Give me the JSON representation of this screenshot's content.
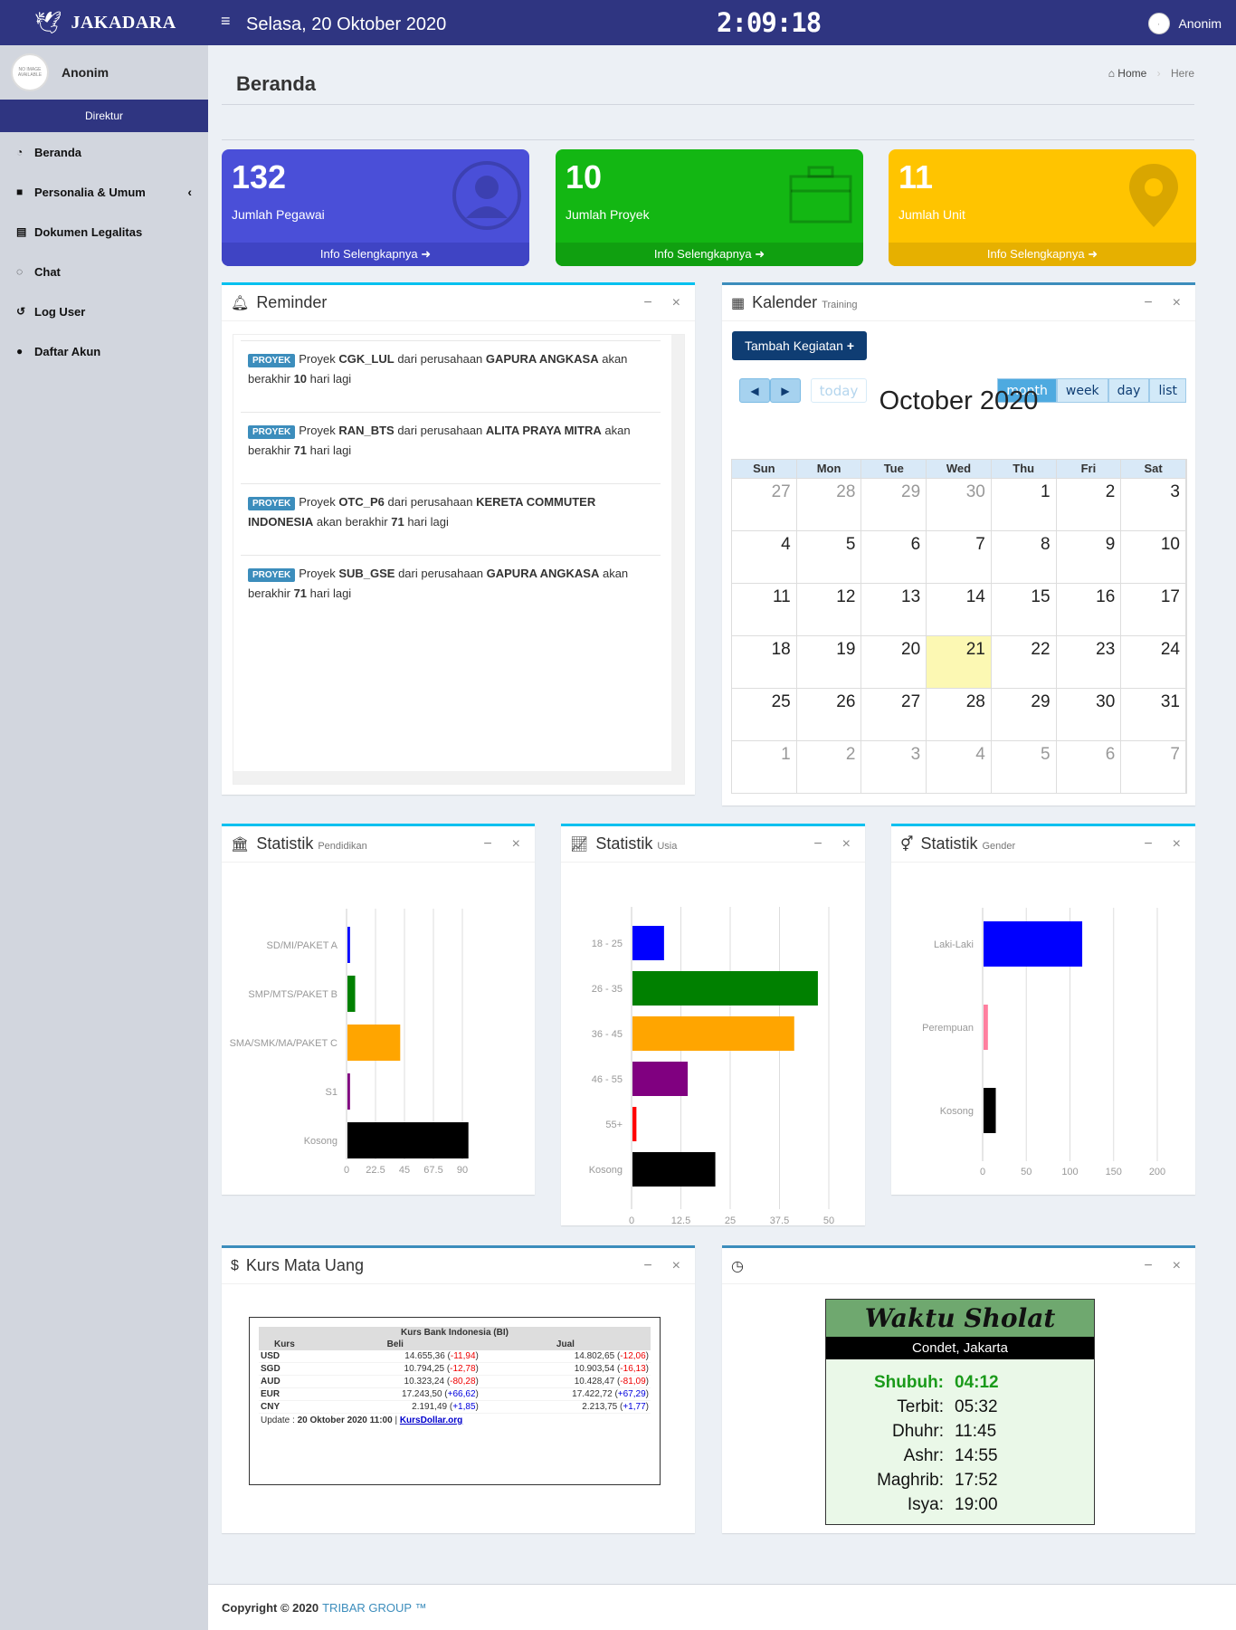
{
  "header": {
    "brand": "JAKADARA",
    "date": "Selasa, 20 Oktober 2020",
    "clock": "2:09:18",
    "user": "Anonim"
  },
  "sidebar": {
    "avatar_text": "NO IMAGE AVAILABLE",
    "user": "Anonim",
    "role": "Direktur",
    "items": [
      {
        "label": "Beranda",
        "icon": "tachometer-icon"
      },
      {
        "label": "Personalia & Umum",
        "icon": "folder-icon"
      },
      {
        "label": "Dokumen Legalitas",
        "icon": "file-icon"
      },
      {
        "label": "Chat",
        "icon": "comments-icon"
      },
      {
        "label": "Log User",
        "icon": "history-icon"
      },
      {
        "label": "Daftar Akun",
        "icon": "user-icon"
      }
    ]
  },
  "page": {
    "title": "Beranda",
    "breadcrumb_home": "Home",
    "breadcrumb_here": "Here"
  },
  "stats": [
    {
      "value": "132",
      "label": "Jumlah Pegawai",
      "link": "Info Selengkapnya",
      "color": "#4a4fd8",
      "foot": "#3f44c4",
      "icon": "user-icon"
    },
    {
      "value": "10",
      "label": "Jumlah Proyek",
      "link": "Info Selengkapnya",
      "color": "#13b713",
      "foot": "#10a010",
      "icon": "briefcase-icon"
    },
    {
      "value": "11",
      "label": "Jumlah Unit",
      "link": "Info Selengkapnya",
      "color": "#ffc400",
      "foot": "#e6b000",
      "icon": "map-marker-icon"
    }
  ],
  "reminder": {
    "title": "Reminder",
    "badge": "PROYEK",
    "items": [
      {
        "w1": "Proyek ",
        "code": "CGK_LUL",
        "w2": " dari perusahaan ",
        "company": "GAPURA ANGKASA",
        "w3": " akan berakhir ",
        "days": "10",
        "w4": " hari lagi"
      },
      {
        "w1": "Proyek ",
        "code": "RAN_BTS",
        "w2": " dari perusahaan ",
        "company": "ALITA PRAYA MITRA",
        "w3": " akan berakhir ",
        "days": "71",
        "w4": " hari lagi"
      },
      {
        "w1": "Proyek ",
        "code": "OTC_P6",
        "w2": " dari perusahaan ",
        "company": "KERETA COMMUTER INDONESIA",
        "w3": " akan berakhir ",
        "days": "71",
        "w4": " hari lagi"
      },
      {
        "w1": "Proyek ",
        "code": "SUB_GSE",
        "w2": " dari perusahaan ",
        "company": "GAPURA ANGKASA",
        "w3": " akan berakhir ",
        "days": "71",
        "w4": " hari lagi"
      }
    ]
  },
  "calendar": {
    "title": "Kalender",
    "subtitle": "Training",
    "add_button": "Tambah Kegiatan",
    "today": "today",
    "views": [
      "month",
      "week",
      "day",
      "list"
    ],
    "active_view": "month",
    "month_title": "October 2020",
    "dow": [
      "Sun",
      "Mon",
      "Tue",
      "Wed",
      "Thu",
      "Fri",
      "Sat"
    ],
    "weeks": [
      [
        "27",
        "28",
        "29",
        "30",
        "1",
        "2",
        "3"
      ],
      [
        "4",
        "5",
        "6",
        "7",
        "8",
        "9",
        "10"
      ],
      [
        "11",
        "12",
        "13",
        "14",
        "15",
        "16",
        "17"
      ],
      [
        "18",
        "19",
        "20",
        "21",
        "22",
        "23",
        "24"
      ],
      [
        "25",
        "26",
        "27",
        "28",
        "29",
        "30",
        "31"
      ],
      [
        "1",
        "2",
        "3",
        "4",
        "5",
        "6",
        "7"
      ]
    ],
    "today_date": "21"
  },
  "chart_titles": {
    "pendidikan": {
      "title": "Statistik",
      "subtitle": "Pendidikan"
    },
    "usia": {
      "title": "Statistik",
      "subtitle": "Usia"
    },
    "gender": {
      "title": "Statistik",
      "subtitle": "Gender"
    }
  },
  "chart_data": [
    {
      "type": "bar",
      "orientation": "horizontal",
      "categories": [
        "SD/MI/PAKET A",
        "SMP/MTS/PAKET B",
        "SMA/SMK/MA/PAKET C",
        "S1",
        "Kosong"
      ],
      "values": [
        2,
        6,
        41,
        2,
        94
      ],
      "colors": [
        "#0000ff",
        "#008000",
        "#ffa500",
        "#800080",
        "#000000"
      ],
      "xlim": [
        0,
        90
      ],
      "xticks": [
        "0",
        "22.5",
        "45",
        "67.5",
        "90"
      ]
    },
    {
      "type": "bar",
      "orientation": "horizontal",
      "categories": [
        "18 - 25",
        "26 - 35",
        "36 - 45",
        "46 - 55",
        "55+",
        "Kosong"
      ],
      "values": [
        8,
        47,
        41,
        14,
        1,
        21
      ],
      "colors": [
        "#0000ff",
        "#008000",
        "#ffa500",
        "#800080",
        "#ff0000",
        "#000000"
      ],
      "xlim": [
        0,
        50
      ],
      "xticks": [
        "0",
        "12.5",
        "25",
        "37.5",
        "50"
      ]
    },
    {
      "type": "bar",
      "orientation": "horizontal",
      "categories": [
        "Laki-Laki",
        "Perempuan",
        "Kosong"
      ],
      "values": [
        113,
        5,
        14
      ],
      "colors": [
        "#0000ff",
        "#ff7f9f",
        "#000000"
      ],
      "xlim": [
        0,
        200
      ],
      "xticks": [
        "0",
        "50",
        "100",
        "150",
        "200"
      ]
    }
  ],
  "kurs": {
    "title": "Kurs Mata Uang",
    "table_title": "Kurs Bank Indonesia (BI)",
    "headers": [
      "Kurs",
      "Beli",
      "Jual"
    ],
    "rows": [
      {
        "cur": "USD",
        "beli": "14.655,36",
        "beli_ch": "-11,94",
        "jual": "14.802,65",
        "jual_ch": "-12,06"
      },
      {
        "cur": "SGD",
        "beli": "10.794,25",
        "beli_ch": "-12,78",
        "jual": "10.903,54",
        "jual_ch": "-16,13"
      },
      {
        "cur": "AUD",
        "beli": "10.323,24",
        "beli_ch": "-80,28",
        "jual": "10.428,47",
        "jual_ch": "-81,09"
      },
      {
        "cur": "EUR",
        "beli": "17.243,50",
        "beli_ch": "+66,62",
        "jual": "17.422,72",
        "jual_ch": "+67,29"
      },
      {
        "cur": "CNY",
        "beli": "2.191,49",
        "beli_ch": "+1,85",
        "jual": "2.213,75",
        "jual_ch": "+1,77"
      }
    ],
    "update_label": "Update : ",
    "update_date": "20 Oktober 2020 11:00",
    "update_sep": " | ",
    "source": "KursDollar.org"
  },
  "sholat": {
    "title": "Waktu Sholat",
    "location": "Condet, Jakarta",
    "times": [
      {
        "name": "Shubuh:",
        "time": "04:12"
      },
      {
        "name": "Terbit:",
        "time": "05:32"
      },
      {
        "name": "Dhuhr:",
        "time": "11:45"
      },
      {
        "name": "Ashr:",
        "time": "14:55"
      },
      {
        "name": "Maghrib:",
        "time": "17:52"
      },
      {
        "name": "Isya:",
        "time": "19:00"
      }
    ]
  },
  "footer": {
    "copyright": "Copyright © 2020",
    "company": "TRIBAR GROUP ™"
  }
}
